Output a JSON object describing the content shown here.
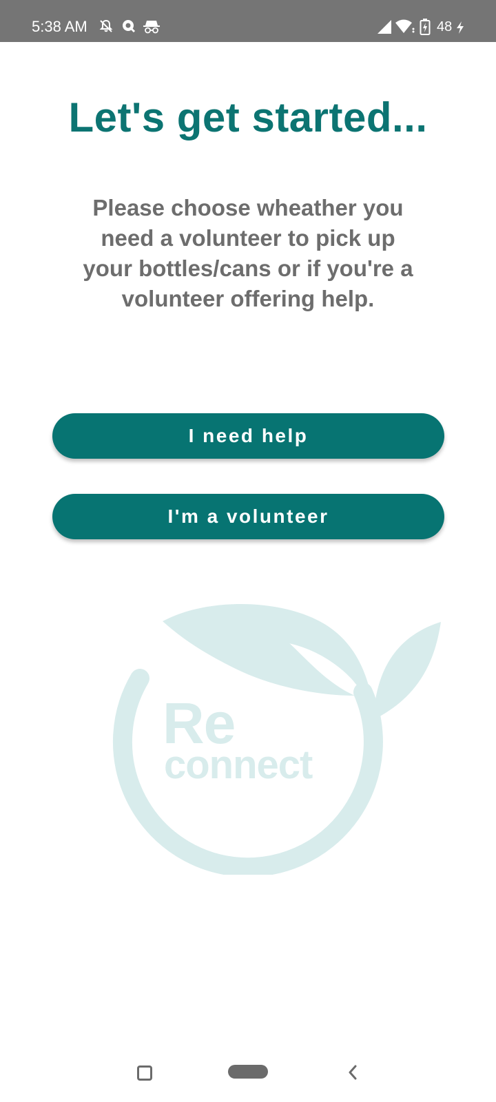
{
  "status_bar": {
    "time": "5:38 AM",
    "battery_percent": "48",
    "icons": [
      "mute-notifications-icon",
      "q-app-icon",
      "incognito-icon",
      "signal-icon",
      "wifi-icon",
      "battery-icon",
      "charging-bolt-icon"
    ]
  },
  "main": {
    "title": "Let's get started...",
    "description": "Please choose wheather you need a volunteer to pick up your bottles/cans or if you're a volunteer offering help.",
    "buttons": {
      "need_help": "I need help",
      "volunteer": "I'm a volunteer"
    }
  },
  "logo": {
    "text_re": "Re",
    "text_connect": "connect",
    "color": "#d8ecec"
  },
  "colors": {
    "accent": "#077472",
    "title": "#0c7472",
    "text_gray": "#6d6d6d",
    "status_bar": "#757575"
  },
  "nav_bar": {
    "icons": [
      "recents-icon",
      "home-icon",
      "back-icon"
    ]
  }
}
